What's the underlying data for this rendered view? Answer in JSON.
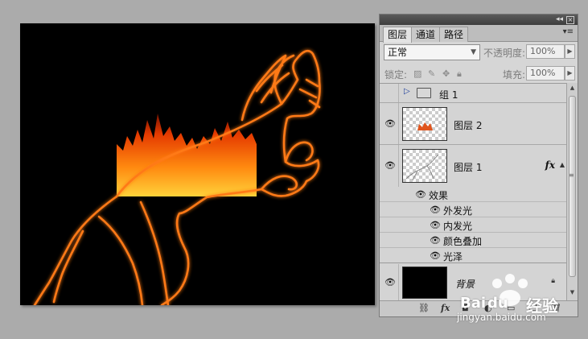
{
  "panel": {
    "tabs": [
      {
        "label": "图层",
        "active": true
      },
      {
        "label": "通道",
        "active": false
      },
      {
        "label": "路径",
        "active": false
      }
    ],
    "blend_mode": "正常",
    "opacity_label": "不透明度:",
    "opacity_value": "100%",
    "lock_label": "锁定:",
    "fill_label": "填充:",
    "fill_value": "100%",
    "layers": [
      {
        "name": "组 1",
        "type": "group",
        "visible": false
      },
      {
        "name": "图层 2",
        "type": "layer",
        "visible": true
      },
      {
        "name": "图层 1",
        "type": "layer",
        "visible": true,
        "fx": "fx"
      },
      {
        "name": "背景",
        "type": "background",
        "visible": true,
        "locked": true
      }
    ],
    "effects_label": "效果",
    "effects": [
      "外发光",
      "内发光",
      "颜色叠加",
      "光泽"
    ]
  },
  "icons": {
    "eye": "eye-icon",
    "folder": "folder-icon",
    "lock": "lock-icon",
    "link": "link-icon",
    "fx": "fx-icon",
    "mask": "mask-icon",
    "adjustment": "adjustment-icon",
    "new_layer": "new-layer-icon",
    "trash": "trash-icon"
  },
  "watermark": {
    "brand": "Bai",
    "brand2": "du",
    "cn": "经验",
    "site": "jingyan.baidu.com"
  },
  "colors": {
    "glow": "#ff7a18",
    "fire": "#ff5a00",
    "canvas": "#000000",
    "panel": "#d6d6d6"
  }
}
